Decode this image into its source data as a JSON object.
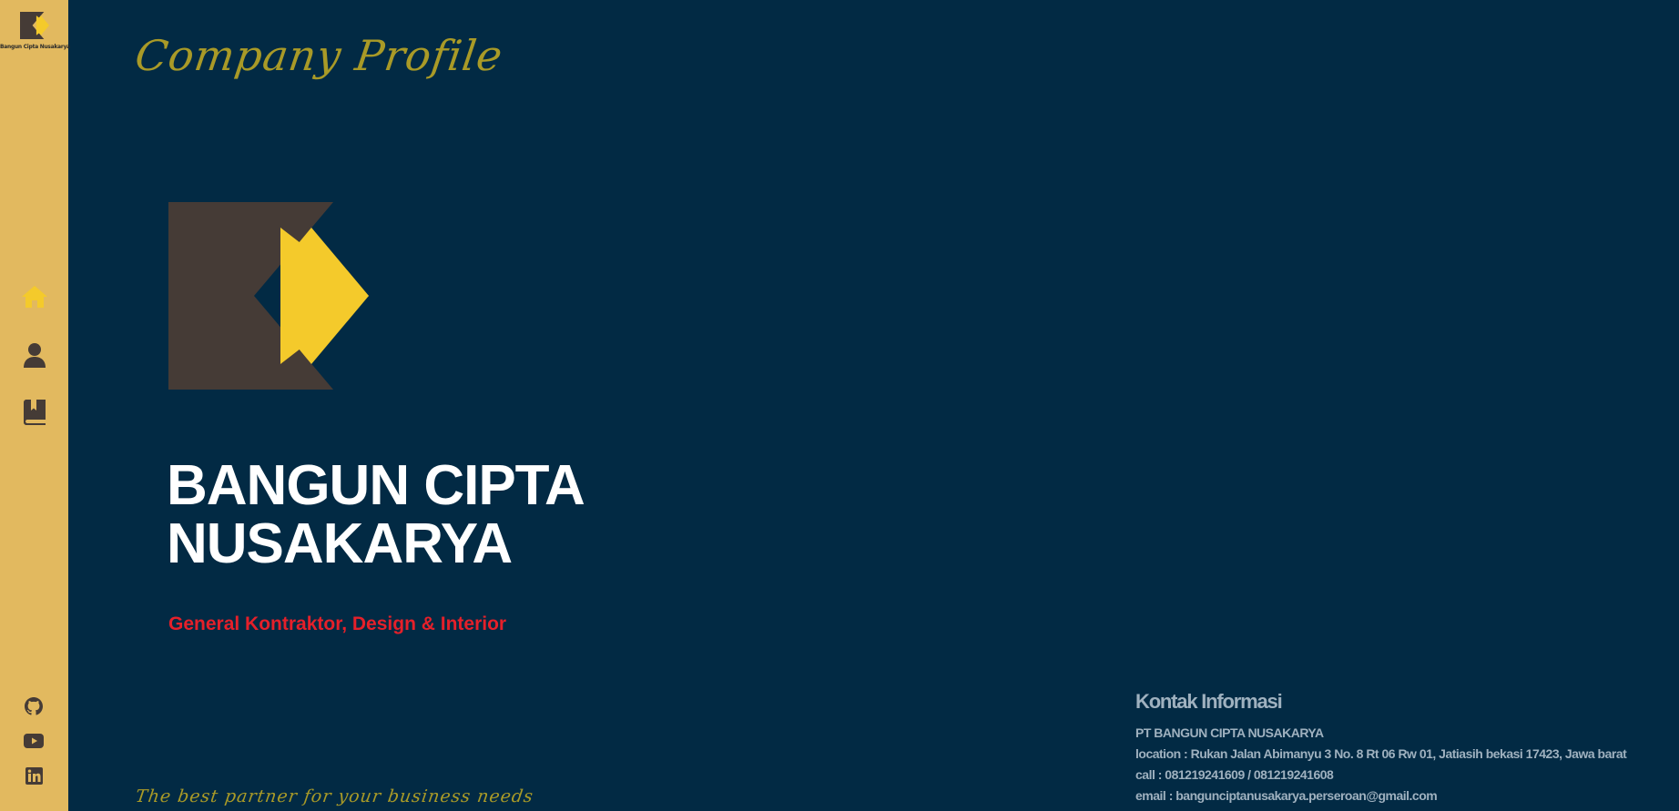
{
  "sidebar": {
    "brand_name": "Bangun Cipta Nusakarya",
    "nav": [
      {
        "icon": "home-icon",
        "label": "Home",
        "active": true
      },
      {
        "icon": "user-icon",
        "label": "Profile",
        "active": false
      },
      {
        "icon": "book-icon",
        "label": "Portfolio",
        "active": false
      }
    ],
    "social": [
      {
        "icon": "github-icon"
      },
      {
        "icon": "youtube-icon"
      },
      {
        "icon": "linkedin-icon"
      }
    ]
  },
  "main": {
    "heading": "Company Profile",
    "title_line1": "BANGUN CIPTA",
    "title_line2": "NUSAKARYA",
    "subtitle": "General Kontraktor, Design & Interior",
    "tagline": "The best partner for your business needs"
  },
  "contact": {
    "title": "Kontak Informasi",
    "company": "PT BANGUN CIPTA NUSAKARYA",
    "location": "location : Rukan Jalan Abimanyu 3 No. 8 Rt 06 Rw 01, Jatiasih bekasi 17423, Jawa barat",
    "call": "call : 081219241609 / 081219241608",
    "email": "email : bangunciptanusakarya.perseroan@gmail.com"
  },
  "colors": {
    "background": "#022a44",
    "sidebar": "#e2b95f",
    "accent_yellow": "#f4ca2b",
    "logo_dark": "#453b36",
    "subtitle_red": "#e5202a",
    "script_olive": "#a99a27",
    "contact_text": "#9fb1bf"
  }
}
